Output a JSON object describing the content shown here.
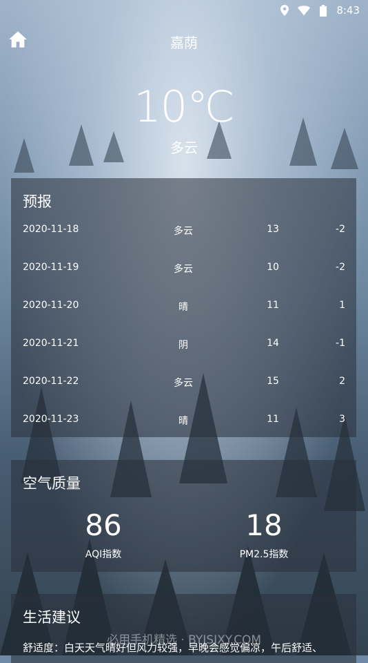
{
  "status": {
    "time": "8:43",
    "location_icon": "location-icon",
    "wifi_icon": "wifi-icon",
    "battery_icon": "battery-icon"
  },
  "header": {
    "city": "嘉荫",
    "home_icon": "home-icon"
  },
  "now": {
    "temperature": "10℃",
    "condition": "多云"
  },
  "forecast": {
    "title": "预报",
    "rows": [
      {
        "date": "2020-11-18",
        "condition": "多云",
        "max": "13",
        "min": "-2"
      },
      {
        "date": "2020-11-19",
        "condition": "多云",
        "max": "10",
        "min": "-2"
      },
      {
        "date": "2020-11-20",
        "condition": "晴",
        "max": "11",
        "min": "1"
      },
      {
        "date": "2020-11-21",
        "condition": "阴",
        "max": "14",
        "min": "-1"
      },
      {
        "date": "2020-11-22",
        "condition": "多云",
        "max": "15",
        "min": "2"
      },
      {
        "date": "2020-11-23",
        "condition": "晴",
        "max": "11",
        "min": "3"
      }
    ]
  },
  "air": {
    "title": "空气质量",
    "aqi_value": "86",
    "aqi_label": "AQI指数",
    "pm25_value": "18",
    "pm25_label": "PM2.5指数"
  },
  "life": {
    "title": "生活建议",
    "comfort": "舒适度：白天天气晴好但风力较强，早晚会感觉偏凉，午后舒适、"
  },
  "watermark": "必用手机精选 · BYJSJXY.COM"
}
